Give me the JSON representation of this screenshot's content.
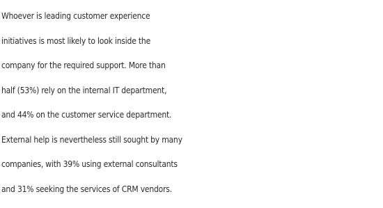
{
  "paragraph": {
    "lines": [
      "Whoever is leading customer experience",
      "initiatives is most likely to look inside the",
      "company for the required support. More than",
      "half (53%) rely on the internal IT department,",
      "and 44% on the customer service department.",
      "External help is nevertheless still sought by many",
      "companies, with 39% using external consultants",
      "and 31% seeking the services of CRM vendors."
    ]
  }
}
